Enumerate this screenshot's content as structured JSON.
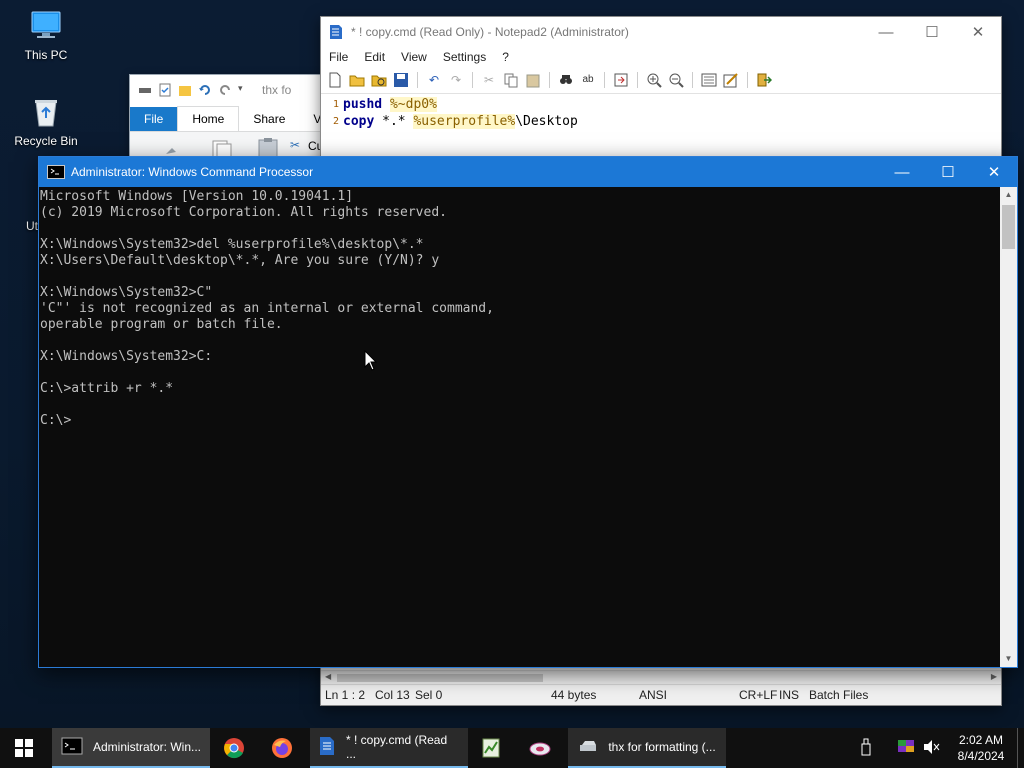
{
  "desktop": {
    "icons": [
      {
        "label": "This PC"
      },
      {
        "label": "Recycle Bin"
      }
    ],
    "partial_label": "Ut"
  },
  "explorer": {
    "title": "thx fo",
    "tabs": [
      "File",
      "Home",
      "Share",
      "V"
    ],
    "ribbon_partial": "Cu"
  },
  "notepad": {
    "title": "* ! copy.cmd (Read Only) - Notepad2 (Administrator)",
    "menu": [
      "File",
      "Edit",
      "View",
      "Settings",
      "?"
    ],
    "lines": [
      {
        "num": "1",
        "kw": "pushd",
        "rest_var": "%~dp0%",
        "rest": ""
      },
      {
        "num": "2",
        "kw": "copy",
        "pre": " *.* ",
        "rest_var": "%userprofile%",
        "rest": "\\Desktop"
      }
    ],
    "status": {
      "position": "Ln 1 : 2",
      "col": "Col 13",
      "sel": "Sel 0",
      "size": "44 bytes",
      "encoding": "ANSI",
      "eol": "CR+LF",
      "mode": "INS",
      "scheme": "Batch Files"
    }
  },
  "cmd": {
    "title": "Administrator: Windows Command Processor",
    "output": "Microsoft Windows [Version 10.0.19041.1]\n(c) 2019 Microsoft Corporation. All rights reserved.\n\nX:\\Windows\\System32>del %userprofile%\\desktop\\*.*\nX:\\Users\\Default\\desktop\\*.*, Are you sure (Y/N)? y\n\nX:\\Windows\\System32>C\"\n'C\"' is not recognized as an internal or external command,\noperable program or batch file.\n\nX:\\Windows\\System32>C:\n\nC:\\>attrib +r *.*\n\nC:\\>"
  },
  "taskbar": {
    "items": [
      {
        "label": "Administrator: Win...",
        "icon": "cmd-icon"
      },
      {
        "label": "* ! copy.cmd (Read ...",
        "icon": "notepad2-icon"
      },
      {
        "label": "thx for formatting (...",
        "icon": "drive-icon"
      }
    ],
    "clock": {
      "time": "2:02 AM",
      "date": "8/4/2024"
    }
  },
  "colors": {
    "accent": "#1c78d6",
    "cmd_bg": "#0c0c0c",
    "cmd_text": "#c0c0c0",
    "taskbar": "#101010"
  }
}
